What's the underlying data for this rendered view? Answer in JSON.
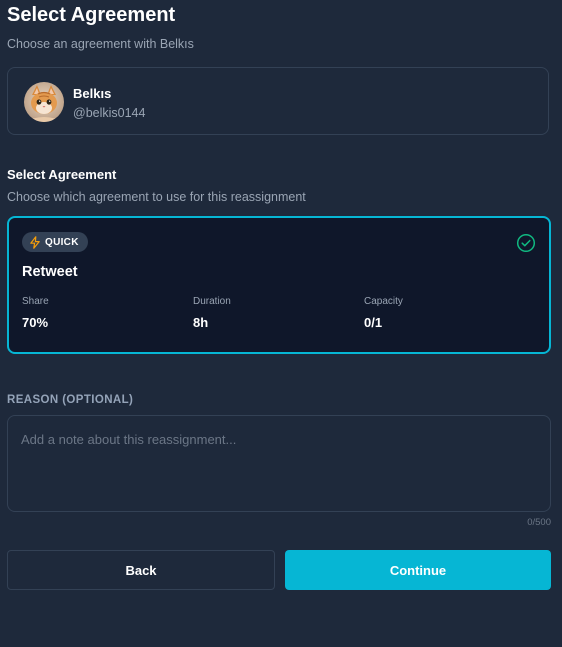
{
  "header": {
    "title": "Select Agreement",
    "subtitle": "Choose an agreement with Belkıs"
  },
  "user": {
    "name": "Belkıs",
    "handle": "@belkis0144",
    "avatar_icon": "kitten-photo"
  },
  "agreement_section": {
    "title": "Select Agreement",
    "subtitle": "Choose which agreement to use for this reassignment"
  },
  "agreement": {
    "badge": "QUICK",
    "badge_icon": "lightning-icon",
    "name": "Retweet",
    "selected": true,
    "stats": [
      {
        "label": "Share",
        "value": "70%"
      },
      {
        "label": "Duration",
        "value": "8h"
      },
      {
        "label": "Capacity",
        "value": "0/1"
      }
    ]
  },
  "reason": {
    "label": "REASON (OPTIONAL)",
    "placeholder": "Add a note about this reassignment...",
    "value": "",
    "counter": "0/500"
  },
  "actions": {
    "back_label": "Back",
    "continue_label": "Continue"
  },
  "colors": {
    "background": "#1e293b",
    "card_selected_bg": "#0f172a",
    "accent": "#06b6d4",
    "badge_icon": "#f59e0b",
    "check": "#10b981",
    "border": "#334155",
    "muted_text": "#9aa5b4"
  }
}
